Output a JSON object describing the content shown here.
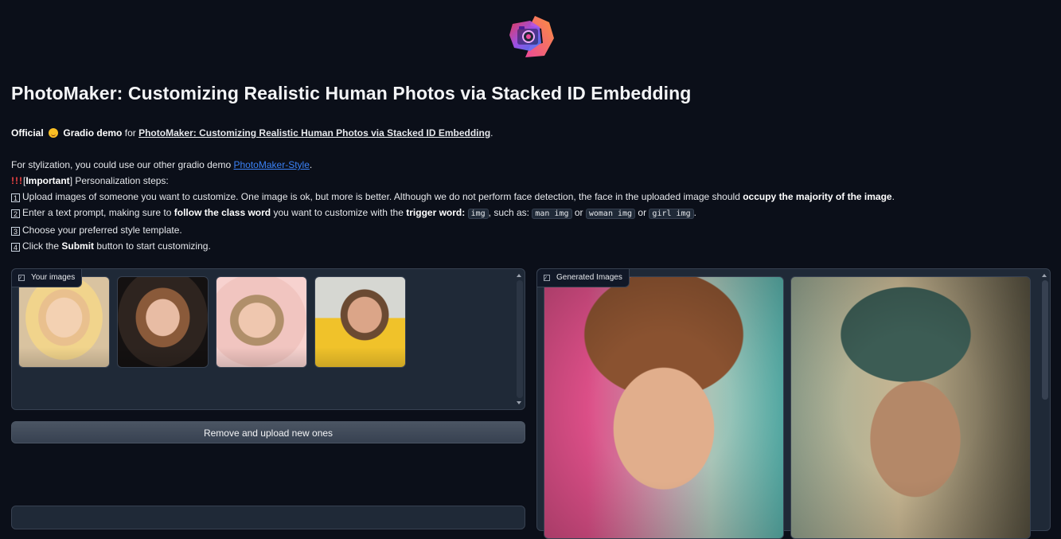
{
  "header": {
    "title": "PhotoMaker: Customizing Realistic Human Photos via Stacked ID Embedding"
  },
  "description": {
    "official": "Official",
    "emoji": "😊",
    "gradio_demo": "Gradio demo",
    "for": "for",
    "paper_link": "PhotoMaker: Customizing Realistic Human Photos via Stacked ID Embedding",
    "period": ".",
    "stylization_prefix": "For stylization, you could use our other gradio demo",
    "style_link": "PhotoMaker-Style",
    "stylization_suffix": ".",
    "important_bang": "!!!",
    "important_label": "[Important]",
    "important_word": "Important",
    "important_rest": "Personalization steps:",
    "step1_num": "1",
    "step1_text": "Upload images of someone you want to customize. One image is ok, but more is better. Although we do not perform face detection, the face in the uploaded image should",
    "step1_bold": "occupy the majority of the image",
    "step1_end": ".",
    "step2_num": "2",
    "step2_text": "Enter a text prompt, making sure to",
    "step2_bold1": "follow the class word",
    "step2_mid": "you want to customize with the",
    "step2_bold2": "trigger word",
    "step2_colon": ":",
    "step2_code1": "img",
    "step2_such": ", such as:",
    "step2_code2": "man img",
    "step2_or1": "or",
    "step2_code3": "woman img",
    "step2_or2": "or",
    "step2_code4": "girl img",
    "step2_end": ".",
    "step3_num": "3",
    "step3_text": "Choose your preferred style template.",
    "step4_num": "4",
    "step4_pre": "Click the",
    "step4_bold": "Submit",
    "step4_post": "button to start customizing."
  },
  "your_images": {
    "label": "Your images",
    "icon": "image-icon",
    "thumbnails": [
      "thumbnail-1",
      "thumbnail-2",
      "thumbnail-3",
      "thumbnail-4"
    ]
  },
  "remove_button": {
    "label": "Remove and upload new ones"
  },
  "generated_images": {
    "label": "Generated Images",
    "icon": "image-icon"
  },
  "colors": {
    "background": "#0b0f19",
    "panel": "#1f2937",
    "border": "#374151",
    "link_blue": "#3b82f6",
    "important_red": "#ef4444"
  }
}
